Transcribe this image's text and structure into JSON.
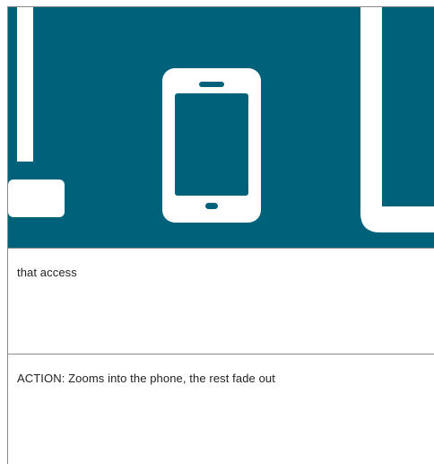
{
  "storyboard": {
    "frame_icon": "smartphone-icon",
    "left_device_icon": "laptop-icon",
    "right_device_icon": "tablet-icon",
    "panel_color": "#00617a",
    "caption_text": "that access",
    "action_text": "ACTION: Zooms into the phone, the rest fade out"
  }
}
